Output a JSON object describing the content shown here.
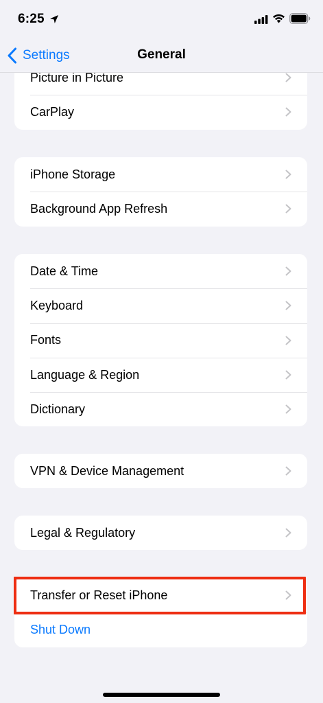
{
  "status_bar": {
    "time": "6:25"
  },
  "nav": {
    "back_label": "Settings",
    "title": "General"
  },
  "groups": [
    {
      "items": [
        {
          "label": "Picture in Picture"
        },
        {
          "label": "CarPlay"
        }
      ]
    },
    {
      "items": [
        {
          "label": "iPhone Storage"
        },
        {
          "label": "Background App Refresh"
        }
      ]
    },
    {
      "items": [
        {
          "label": "Date & Time"
        },
        {
          "label": "Keyboard"
        },
        {
          "label": "Fonts"
        },
        {
          "label": "Language & Region"
        },
        {
          "label": "Dictionary"
        }
      ]
    },
    {
      "items": [
        {
          "label": "VPN & Device Management"
        }
      ]
    },
    {
      "items": [
        {
          "label": "Legal & Regulatory"
        }
      ]
    },
    {
      "items": [
        {
          "label": "Transfer or Reset iPhone"
        },
        {
          "label": "Shut Down"
        }
      ]
    }
  ],
  "colors": {
    "accent": "#0a7aff",
    "highlight": "#ee2e12",
    "background": "#f2f2f7"
  },
  "icons": {
    "location": "location-arrow-icon",
    "cellular": "cellular-signal-icon",
    "wifi": "wifi-icon",
    "battery": "battery-icon",
    "chevron": "chevron-right-icon",
    "back": "chevron-left-icon"
  }
}
